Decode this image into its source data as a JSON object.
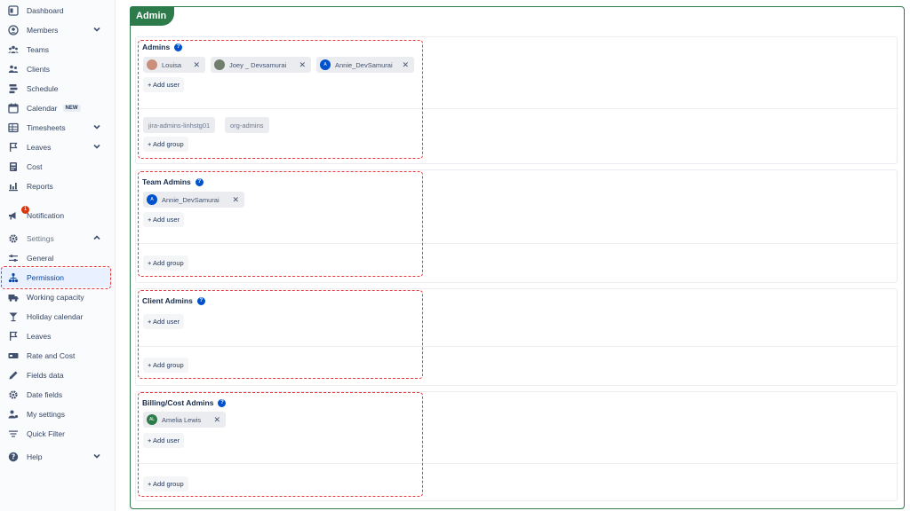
{
  "sidebar": {
    "items": [
      {
        "label": "Dashboard",
        "icon": "dashboard-icon"
      },
      {
        "label": "Members",
        "icon": "members-icon"
      },
      {
        "label": "Teams",
        "icon": "teams-icon"
      },
      {
        "label": "Clients",
        "icon": "clients-icon"
      },
      {
        "label": "Schedule",
        "icon": "schedule-icon"
      },
      {
        "label": "Calendar",
        "icon": "calendar-icon",
        "badge": "NEW"
      },
      {
        "label": "Timesheets",
        "icon": "timesheets-icon"
      },
      {
        "label": "Leaves",
        "icon": "flag-icon"
      },
      {
        "label": "Cost",
        "icon": "cost-icon"
      },
      {
        "label": "Reports",
        "icon": "reports-icon"
      }
    ],
    "notification": {
      "label": "Notification",
      "count": "1"
    },
    "settings": {
      "label": "Settings"
    },
    "settings_items": [
      {
        "label": "General"
      },
      {
        "label": "Permission"
      },
      {
        "label": "Working capacity"
      },
      {
        "label": "Holiday calendar"
      },
      {
        "label": "Leaves"
      },
      {
        "label": "Rate and Cost"
      },
      {
        "label": "Fields data"
      },
      {
        "label": "Date fields"
      },
      {
        "label": "My settings"
      },
      {
        "label": "Quick Filter"
      }
    ],
    "help": {
      "label": "Help"
    }
  },
  "panel": {
    "title": "Admin"
  },
  "sections": {
    "admins": {
      "title": "Admins",
      "users": [
        {
          "name": "Louisa",
          "avatar_color": "#c98f7c"
        },
        {
          "name": "Joey _ Devsamurai",
          "avatar_color": "#6f7f6b"
        },
        {
          "name": "Annie_DevSamurai",
          "avatar_color": "#0052cc",
          "initial": "A"
        }
      ],
      "add_user": "+ Add user",
      "groups": [
        "jira-admins-linhstg01",
        "org-admins"
      ],
      "add_group": "+ Add group"
    },
    "team_admins": {
      "title": "Team Admins",
      "users": [
        {
          "name": "Annie_DevSamurai",
          "avatar_color": "#0052cc",
          "initial": "A"
        }
      ],
      "add_user": "+ Add user",
      "add_group": "+ Add group"
    },
    "client_admins": {
      "title": "Client Admins",
      "add_user": "+ Add user",
      "add_group": "+ Add group"
    },
    "billing_admins": {
      "title": "Billing/Cost Admins",
      "users": [
        {
          "name": "Amelia Lewis",
          "avatar_color": "#2d7a4b",
          "initial": "AL"
        }
      ],
      "add_user": "+ Add user",
      "add_group": "+ Add group"
    }
  },
  "help_glyph": "?",
  "close_glyph": "✕"
}
